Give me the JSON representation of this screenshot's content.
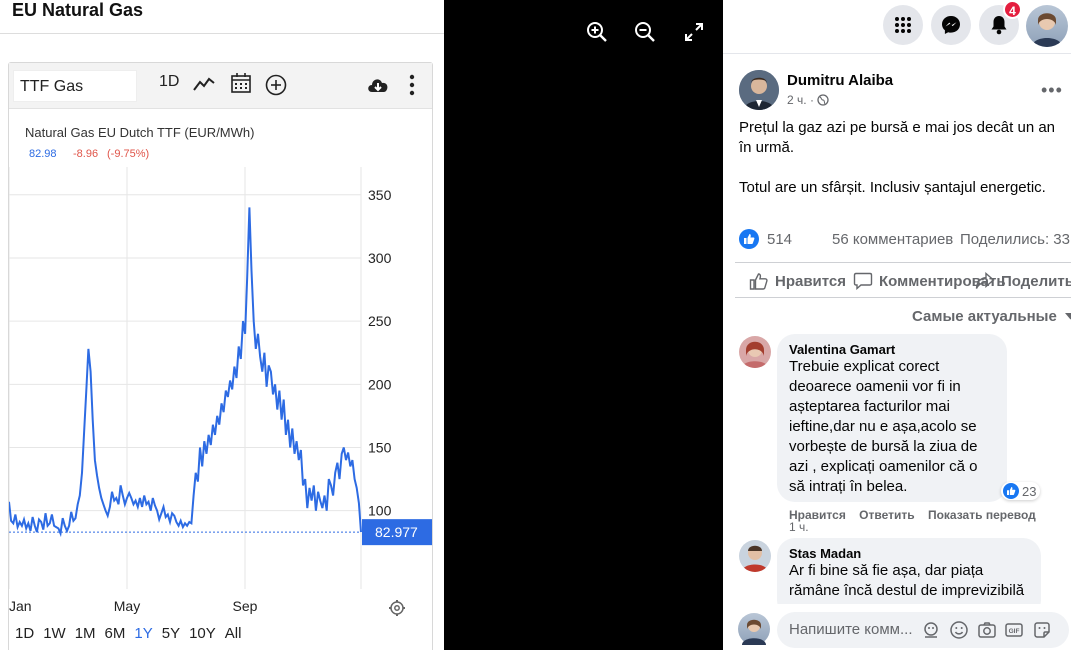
{
  "image_panel": {
    "title": "EU Natural Gas",
    "toolbar": {
      "symbol": "TTF Gas",
      "interval": "1D"
    },
    "chart_header": {
      "name": "Natural Gas EU Dutch TTF (EUR/MWh)",
      "price": "82.98",
      "change": "-8.96",
      "change_pct": "(-9.75%)"
    },
    "last_price_label": "82.977",
    "time_ranges": [
      "1D",
      "1W",
      "1M",
      "6M",
      "1Y",
      "5Y",
      "10Y",
      "All"
    ],
    "active_range": "1Y",
    "colors": {
      "line": "#2d6be3",
      "accent": "#2d6be3",
      "negative": "#e0554a"
    }
  },
  "chart_data": {
    "type": "line",
    "title": "Natural Gas EU Dutch TTF (EUR/MWh)",
    "x_ticks": [
      "Jan",
      "May",
      "Sep"
    ],
    "y_ticks": [
      100,
      150,
      200,
      250,
      300,
      350
    ],
    "ylim": [
      38,
      372
    ],
    "grid": true,
    "series": [
      {
        "name": "TTF Gas",
        "values": [
          107,
          92,
          90,
          97,
          87,
          91,
          88,
          93,
          86,
          90,
          84,
          95,
          88,
          83,
          93,
          91,
          85,
          98,
          88,
          90,
          97,
          88,
          87,
          86,
          82,
          94,
          88,
          84,
          88,
          99,
          92,
          94,
          105,
          112,
          130,
          162,
          195,
          228,
          210,
          172,
          140,
          128,
          118,
          110,
          105,
          100,
          96,
          103,
          115,
          108,
          110,
          105,
          120,
          112,
          105,
          110,
          114,
          110,
          105,
          108,
          103,
          110,
          103,
          112,
          105,
          107,
          100,
          110,
          104,
          100,
          93,
          98,
          103,
          95,
          97,
          91,
          98,
          96,
          91,
          88,
          92,
          87,
          90,
          88,
          91,
          90,
          112,
          130,
          123,
          150,
          135,
          155,
          145,
          160,
          152,
          168,
          160,
          175,
          168,
          185,
          178,
          195,
          190,
          203,
          196,
          214,
          205,
          230,
          220,
          250,
          240,
          285,
          340,
          290,
          250,
          228,
          240,
          222,
          210,
          225,
          198,
          215,
          210,
          192,
          200,
          180,
          195,
          172,
          188,
          160,
          172,
          150,
          165,
          145,
          155,
          140,
          148,
          120,
          125,
          102,
          118,
          108,
          120,
          100,
          115,
          108,
          102,
          112,
          100,
          125,
          120,
          112,
          130,
          138,
          125,
          145,
          150,
          140,
          146,
          135,
          140,
          125,
          118,
          106,
          83
        ]
      }
    ]
  },
  "viewer_controls": {
    "zoom_in_icon": "magnifier-plus-icon",
    "zoom_out_icon": "magnifier-minus-icon",
    "fullscreen_icon": "expand-icon"
  },
  "facebook": {
    "notifications_count": "4",
    "post": {
      "author": "Dumitru Alaiba",
      "time": "2 ч.",
      "paragraphs": [
        "Prețul la gaz azi pe bursă e mai jos decât un an în urmă.",
        "Totul are un sfârșit. Inclusiv șantajul energetic."
      ],
      "likes": "514",
      "comments": "56 комментариев",
      "shares": "Поделились: 33"
    },
    "actions": {
      "like": "Нравится",
      "comment": "Комментировать",
      "share": "Поделиться"
    },
    "sort_label": "Самые актуальные",
    "comments": [
      {
        "name": "Valentina Gamart",
        "text": "Trebuie explicat corect deoarece oamenii vor fi in așteptarea facturilor mai ieftine,dar nu e așa,acolo se vorbește de bursă la ziua de azi , explicați oamenilor că o să intrați în belea.",
        "reactions": "23",
        "like": "Нравится",
        "reply": "Ответить",
        "translate": "Показать перевод",
        "time": "1 ч."
      },
      {
        "name": "Stas Madan",
        "text": "Ar fi bine să fie așa, dar piața rămâne încă destul de imprevizibilă"
      }
    ],
    "composer_placeholder": "Напишите комм..."
  }
}
